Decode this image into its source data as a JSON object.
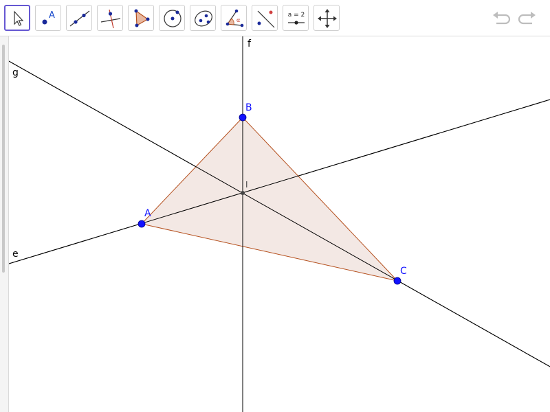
{
  "toolbar": {
    "tools": [
      {
        "id": "move",
        "active": true
      },
      {
        "id": "point",
        "icon_text": "A"
      },
      {
        "id": "line"
      },
      {
        "id": "perpendicular-line"
      },
      {
        "id": "polygon"
      },
      {
        "id": "circle-center-point"
      },
      {
        "id": "ellipse"
      },
      {
        "id": "angle",
        "icon_text": "α"
      },
      {
        "id": "reflect-about-line"
      },
      {
        "id": "slider",
        "icon_text": "a = 2"
      },
      {
        "id": "move-graphics-view"
      }
    ],
    "undo": "undo-icon",
    "redo": "redo-icon"
  },
  "geometry": {
    "lines": {
      "f": "f",
      "g": "g",
      "e": "e"
    },
    "points": {
      "A": "A",
      "B": "B",
      "C": "C",
      "I": "I"
    },
    "colors": {
      "point": "#1212ff",
      "polygon_fill": "#f2e6e1",
      "polygon_stroke": "#b5501e",
      "line": "#000000",
      "intersection": "#444444"
    }
  }
}
